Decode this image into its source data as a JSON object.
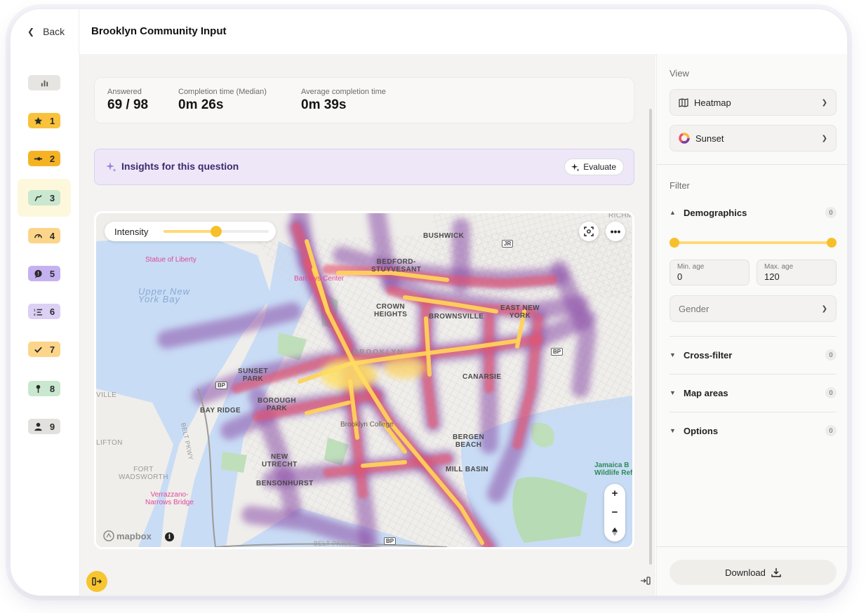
{
  "header": {
    "back_label": "Back",
    "title": "Brooklyn Community Input"
  },
  "sidebar": {
    "items": [
      {
        "number": "",
        "icon": "bar-chart-icon",
        "color": "#e7e5e2"
      },
      {
        "number": "1",
        "icon": "star-icon",
        "color": "#f9c23c"
      },
      {
        "number": "2",
        "icon": "slider-icon",
        "color": "#f5b324"
      },
      {
        "number": "3",
        "icon": "route-icon",
        "color": "#c9e8cf",
        "active": true
      },
      {
        "number": "4",
        "icon": "gauge-icon",
        "color": "#fcd58a"
      },
      {
        "number": "5",
        "icon": "speech-icon",
        "color": "#c5b1f0"
      },
      {
        "number": "6",
        "icon": "ranking-icon",
        "color": "#dcd0f5"
      },
      {
        "number": "7",
        "icon": "check-icon",
        "color": "#fcd58a"
      },
      {
        "number": "8",
        "icon": "pin-icon",
        "color": "#c9e8cf"
      },
      {
        "number": "9",
        "icon": "person-icon",
        "color": "#e3e1de"
      }
    ]
  },
  "stats": {
    "answered_label": "Answered",
    "answered_value": "69 / 98",
    "median_label": "Completion time (Median)",
    "median_value": "0m 26s",
    "average_label": "Average completion time",
    "average_value": "0m 39s"
  },
  "insights": {
    "title": "Insights for this question",
    "evaluate_label": "Evaluate"
  },
  "map": {
    "intensity_label": "Intensity",
    "intensity_level": 0.5,
    "attribution": "mapbox",
    "labels": {
      "bushwick": "BUSHWICK",
      "bedford": "BEDFORD-\nSTUYVESANT",
      "crown": "CROWN\nHEIGHTS",
      "brownsville": "BROWNSVILLE",
      "eastny": "EAST NEW\nYORK",
      "brooklyn": "BROOKLYN",
      "canarsie": "CANARSIE",
      "sunset": "SUNSET\nPARK",
      "borough": "BOROUGH\nPARK",
      "bayridge": "BAY RIDGE",
      "college": "Brooklyn College",
      "bergen": "BERGEN\nBEACH",
      "millbasin": "MILL BASIN",
      "newutrecht": "NEW\nUTRECHT",
      "bensonhurst": "BENSONHURST",
      "statue": "Statue of Liberty",
      "barclays": "Barclays Center",
      "upperbay": "Upper New\nYork Bay",
      "richmo": "RICHMO",
      "ville": "VILLE",
      "lifton": "LIFTON",
      "fort": "FORT\nWADSWORTH",
      "verrazzano": "Verrazzano-\nNarrows Bridge",
      "jamaica": "Jamaica B\nWildlife Ref",
      "beltpkwy": "BELT PKWY",
      "beltpkwy2": "BELT PKWY",
      "shield_bp1": "BP",
      "shield_bp2": "BP",
      "shield_bp3": "BP",
      "shield_jr": "JR"
    }
  },
  "panel": {
    "view_label": "View",
    "view_mode": "Heatmap",
    "color_scheme": "Sunset",
    "filter_label": "Filter",
    "demographics": {
      "title": "Demographics",
      "count": "0"
    },
    "min_age_label": "Min. age",
    "min_age_value": "0",
    "max_age_label": "Max. age",
    "max_age_value": "120",
    "gender_placeholder": "Gender",
    "cross_filter": {
      "title": "Cross-filter",
      "count": "0"
    },
    "map_areas": {
      "title": "Map areas",
      "count": "0"
    },
    "options": {
      "title": "Options",
      "count": "0"
    },
    "download_label": "Download"
  },
  "colors": {
    "accent": "#f7c02a",
    "insight_bg": "#ede7f8",
    "heat_low": "#7b3f99",
    "heat_mid": "#e8546a",
    "heat_high": "#ffd25a"
  }
}
